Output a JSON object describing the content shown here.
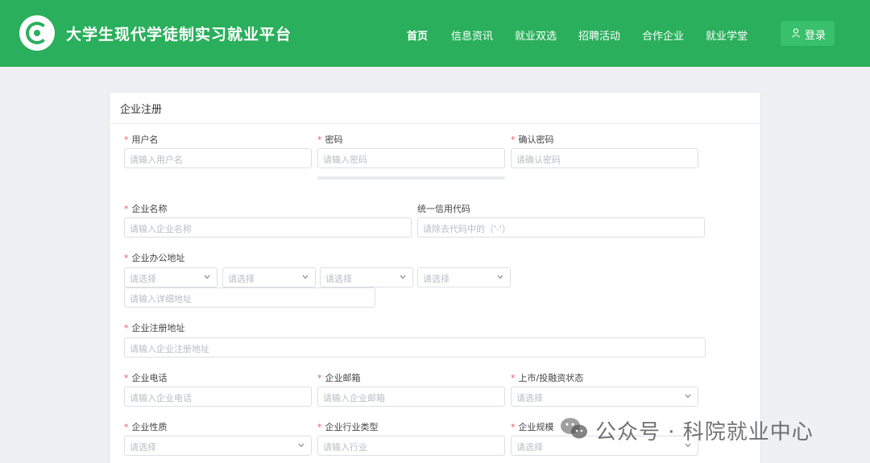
{
  "header": {
    "site_title": "大学生现代学徒制实习就业平台",
    "nav": [
      "首页",
      "信息资讯",
      "就业双选",
      "招聘活动",
      "合作企业",
      "就业学堂"
    ],
    "login_label": "登录",
    "brand_color": "#2aaf5c"
  },
  "form": {
    "title": "企业注册",
    "required_mark": "*",
    "username_label": "用户名",
    "username_placeholder": "请输入用户名",
    "password_label": "密码",
    "password_placeholder": "请输入密码",
    "confirm_label": "确认密码",
    "confirm_placeholder": "请确认密码",
    "company_name_label": "企业名称",
    "company_name_placeholder": "请输入企业名称",
    "credit_code_label": "统一信用代码",
    "credit_code_placeholder": "请除去代码中的（'-'）",
    "office_address_label": "企业办公地址",
    "select_placeholder": "请选择",
    "detail_address_placeholder": "请输入详细地址",
    "reg_address_label": "企业注册地址",
    "reg_address_placeholder": "请输入企业注册地址",
    "phone_label": "企业电话",
    "phone_placeholder": "请输入企业电话",
    "email_label": "企业邮箱",
    "email_placeholder": "请输入企业邮箱",
    "listing_label": "上市/投融资状态",
    "nature_label": "企业性质",
    "industry_label": "企业行业类型",
    "industry_placeholder": "请输入行业",
    "scale_label": "企业规模"
  },
  "watermark": {
    "text": "公众号 · 科院就业中心"
  }
}
